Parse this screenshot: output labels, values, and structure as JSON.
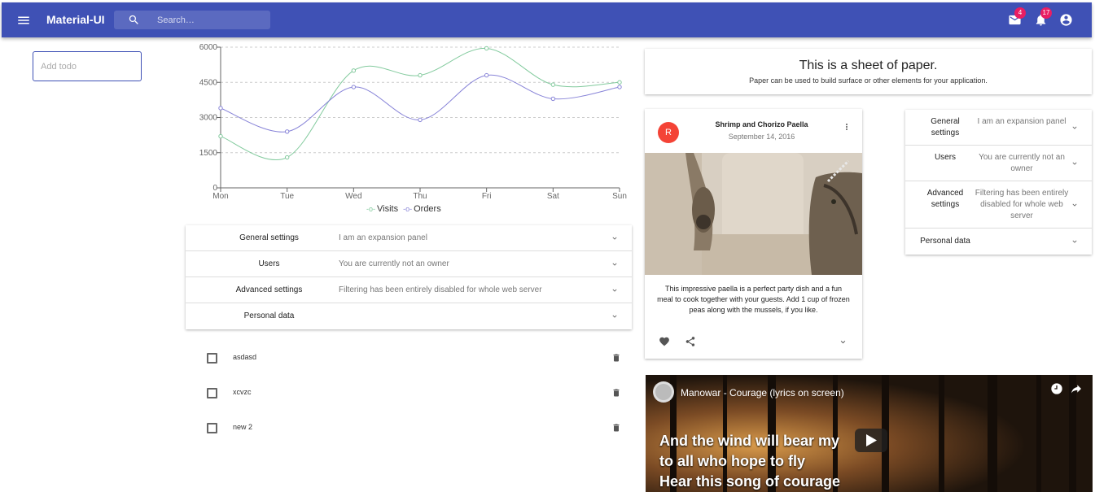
{
  "appbar": {
    "title": "Material-UI",
    "search_placeholder": "Search…",
    "mail_badge": "4",
    "notifications_badge": "17",
    "bg_color": "#3f51b5",
    "badge_color": "#e91e63"
  },
  "todo_input": {
    "placeholder": "Add todo"
  },
  "chart_data": {
    "type": "line",
    "categories": [
      "Mon",
      "Tue",
      "Wed",
      "Thu",
      "Fri",
      "Sat",
      "Sun"
    ],
    "series": [
      {
        "name": "Visits",
        "values": [
          2200,
          1300,
          5000,
          4800,
          5950,
          4400,
          4500
        ],
        "color": "#82ca9d"
      },
      {
        "name": "Orders",
        "values": [
          3400,
          2400,
          4300,
          2900,
          4800,
          3800,
          4300
        ],
        "color": "#8884d8"
      }
    ],
    "y_ticks": [
      "0",
      "1500",
      "3000",
      "4500",
      "6000"
    ],
    "ylim": [
      0,
      6000
    ],
    "grid": "horizontal dashed",
    "legend": "bottom"
  },
  "panel_wide": {
    "rows": [
      {
        "heading": "General settings",
        "secondary": "I am an expansion panel"
      },
      {
        "heading": "Users",
        "secondary": "You are currently not an owner"
      },
      {
        "heading": "Advanced settings",
        "secondary": "Filtering has been entirely disabled for whole web server"
      },
      {
        "heading": "Personal data",
        "secondary": ""
      }
    ]
  },
  "todos": [
    {
      "text": "asdasd"
    },
    {
      "text": "xcvzc"
    },
    {
      "text": "new 2"
    }
  ],
  "paper": {
    "heading": "This is a sheet of paper.",
    "body": "Paper can be used to build surface or other elements for your application."
  },
  "card": {
    "avatar": "R",
    "title": "Shrimp and Chorizo Paella",
    "subheader": "September 14, 2016",
    "body": "This impressive paella is a perfect party dish and a fun meal to cook together with your guests. Add 1 cup of frozen peas along with the mussels, if you like.",
    "avatar_color": "#f44336"
  },
  "panel_small": {
    "rows": [
      {
        "heading": "General settings",
        "secondary": "I am an expansion panel"
      },
      {
        "heading": "Users",
        "secondary": "You are currently not an owner"
      },
      {
        "heading": "Advanced settings",
        "secondary": "Filtering has been entirely disabled for whole web server"
      },
      {
        "heading": "Personal data",
        "secondary": ""
      }
    ]
  },
  "video": {
    "title": "Manowar - Courage (lyrics on screen)",
    "lyrics": [
      "And the wind will bear my",
      "to all who hope to fly",
      "Hear this song of courage"
    ]
  }
}
